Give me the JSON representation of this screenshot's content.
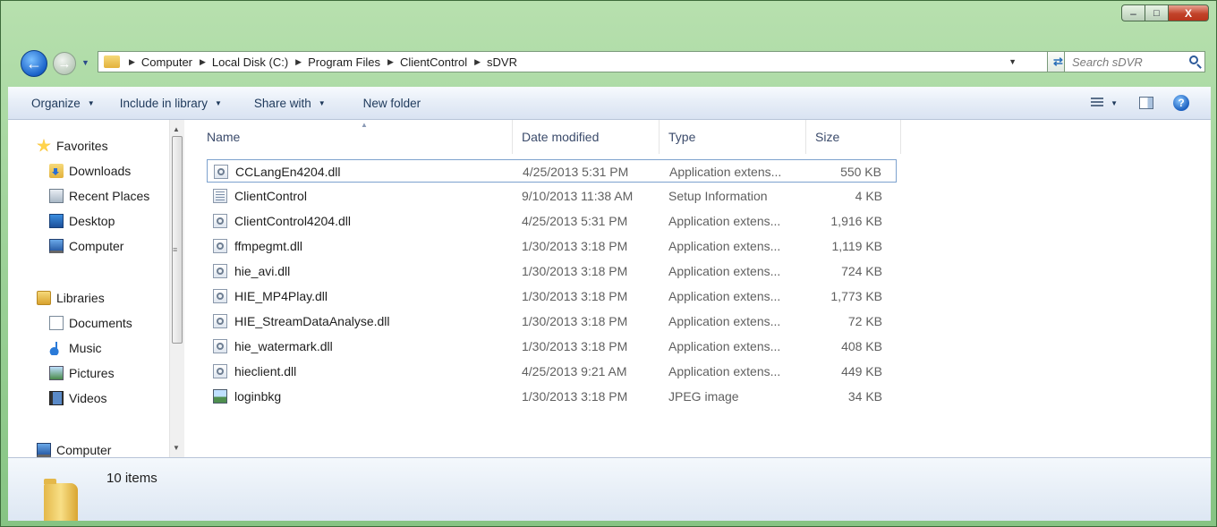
{
  "window": {
    "caption_min": "–",
    "caption_max": "□",
    "caption_close": "X"
  },
  "address_bar": {
    "crumbs": [
      "Computer",
      "Local Disk (C:)",
      "Program Files",
      "ClientControl",
      "sDVR"
    ]
  },
  "search": {
    "placeholder": "Search sDVR"
  },
  "toolbar": {
    "organize": "Organize",
    "include": "Include in library",
    "share": "Share with",
    "new_folder": "New folder"
  },
  "nav_pane": {
    "items": [
      {
        "label": "Favorites",
        "icon": "star-icon"
      },
      {
        "label": "Downloads",
        "icon": "downloads-folder-icon"
      },
      {
        "label": "Recent Places",
        "icon": "recent-places-icon"
      },
      {
        "label": "Desktop",
        "icon": "desktop-icon"
      },
      {
        "label": "Computer",
        "icon": "computer-icon"
      },
      {
        "label": "Libraries",
        "icon": "libraries-icon"
      },
      {
        "label": "Documents",
        "icon": "documents-icon"
      },
      {
        "label": "Music",
        "icon": "music-icon"
      },
      {
        "label": "Pictures",
        "icon": "pictures-icon"
      },
      {
        "label": "Videos",
        "icon": "videos-icon"
      },
      {
        "label": "Computer",
        "icon": "computer-icon"
      }
    ]
  },
  "columns": {
    "name": "Name",
    "date": "Date modified",
    "type": "Type",
    "size": "Size"
  },
  "files": [
    {
      "name": "CCLangEn4204.dll",
      "date": "4/25/2013 5:31 PM",
      "type": "Application extens...",
      "size": "550 KB",
      "icon": "dll-file-icon"
    },
    {
      "name": "ClientControl",
      "date": "9/10/2013 11:38 AM",
      "type": "Setup Information",
      "size": "4 KB",
      "icon": "setup-info-file-icon"
    },
    {
      "name": "ClientControl4204.dll",
      "date": "4/25/2013 5:31 PM",
      "type": "Application extens...",
      "size": "1,916 KB",
      "icon": "dll-file-icon"
    },
    {
      "name": "ffmpegmt.dll",
      "date": "1/30/2013 3:18 PM",
      "type": "Application extens...",
      "size": "1,119 KB",
      "icon": "dll-file-icon"
    },
    {
      "name": "hie_avi.dll",
      "date": "1/30/2013 3:18 PM",
      "type": "Application extens...",
      "size": "724 KB",
      "icon": "dll-file-icon"
    },
    {
      "name": "HIE_MP4Play.dll",
      "date": "1/30/2013 3:18 PM",
      "type": "Application extens...",
      "size": "1,773 KB",
      "icon": "dll-file-icon"
    },
    {
      "name": "HIE_StreamDataAnalyse.dll",
      "date": "1/30/2013 3:18 PM",
      "type": "Application extens...",
      "size": "72 KB",
      "icon": "dll-file-icon"
    },
    {
      "name": "hie_watermark.dll",
      "date": "1/30/2013 3:18 PM",
      "type": "Application extens...",
      "size": "408 KB",
      "icon": "dll-file-icon"
    },
    {
      "name": "hieclient.dll",
      "date": "4/25/2013 9:21 AM",
      "type": "Application extens...",
      "size": "449 KB",
      "icon": "dll-file-icon"
    },
    {
      "name": "loginbkg",
      "date": "1/30/2013 3:18 PM",
      "type": "JPEG image",
      "size": "34 KB",
      "icon": "jpeg-image-icon"
    }
  ],
  "details_pane": {
    "item_count": "10 items"
  }
}
